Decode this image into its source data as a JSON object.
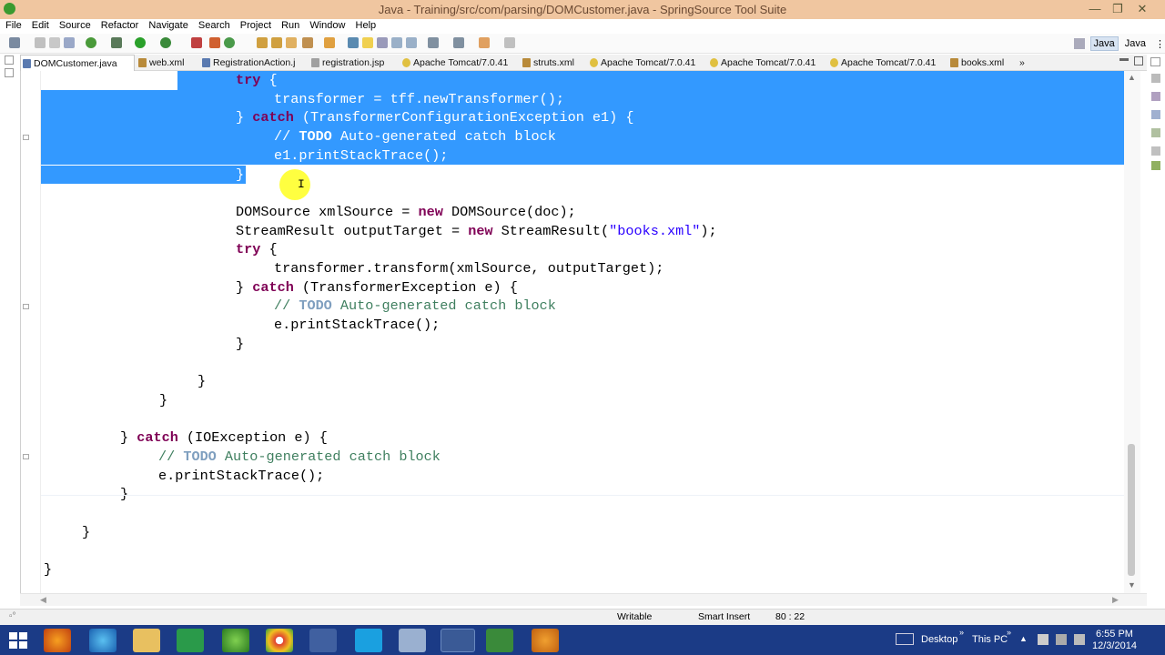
{
  "window": {
    "title": "Java - Training/src/com/parsing/DOMCustomer.java - SpringSource Tool Suite",
    "minimize": "—",
    "maximize": "❐",
    "close": "✕"
  },
  "menu": [
    "File",
    "Edit",
    "Source",
    "Refactor",
    "Navigate",
    "Search",
    "Project",
    "Run",
    "Window",
    "Help"
  ],
  "perspectives": [
    "Java",
    "Java"
  ],
  "tabs": [
    {
      "label": "DOMCustomer.java",
      "active": true
    },
    {
      "label": "web.xml",
      "active": false
    },
    {
      "label": "RegistrationAction.j",
      "active": false
    },
    {
      "label": "registration.jsp",
      "active": false
    },
    {
      "label": "Apache Tomcat/7.0.41",
      "active": false
    },
    {
      "label": "struts.xml",
      "active": false
    },
    {
      "label": "Apache Tomcat/7.0.41",
      "active": false
    },
    {
      "label": "Apache Tomcat/7.0.41",
      "active": false
    },
    {
      "label": "Apache Tomcat/7.0.41",
      "active": false
    },
    {
      "label": "books.xml",
      "active": false
    }
  ],
  "tab_overflow": "»",
  "code": {
    "l1_kw": "try",
    "l1_rest": " {",
    "l2": "transformer = tff.newTransformer();",
    "l3_a": "} ",
    "l3_kw": "catch",
    "l3_b": " (TransformerConfigurationException e1) {",
    "l4_a": "// ",
    "l4_tag": "TODO",
    "l4_b": " Auto-generated catch block",
    "l5": "e1.printStackTrace();",
    "l6": "}",
    "l7_a": "DOMSource xmlSource = ",
    "l7_kw": "new",
    "l7_b": " DOMSource(doc);",
    "l8_a": "StreamResult outputTarget = ",
    "l8_kw": "new",
    "l8_b": " StreamResult(",
    "l8_str": "\"books.xml\"",
    "l8_c": ");",
    "l9_kw": "try",
    "l9_rest": " {",
    "l10": "transformer.transform(xmlSource, outputTarget);",
    "l11_a": "} ",
    "l11_kw": "catch",
    "l11_b": " (TransformerException e) {",
    "l12_a": "// ",
    "l12_tag": "TODO",
    "l12_b": " Auto-generated catch block",
    "l13": "e.printStackTrace();",
    "l14": "}",
    "l15": "}",
    "l16": "}",
    "l17_a": "} ",
    "l17_kw": "catch",
    "l17_b": " (IOException e) {",
    "l18_a": "// ",
    "l18_tag": "TODO",
    "l18_b": " Auto-generated catch block",
    "l19": "e.printStackTrace();",
    "l20": "}",
    "l21": "}",
    "l22": "}"
  },
  "status": {
    "writable": "Writable",
    "insert_mode": "Smart Insert",
    "position": "80 : 22"
  },
  "taskbar": {
    "desktop": "Desktop",
    "this_pc": "This PC",
    "time": "6:55 PM",
    "date": "12/3/2014"
  },
  "colors": {
    "selection": "#3399ff",
    "keyword": "#7f0055",
    "comment": "#3f7f5f",
    "string": "#2a00ff",
    "taskbar": "#1b3b86",
    "titlebar": "#f0c6a0"
  }
}
